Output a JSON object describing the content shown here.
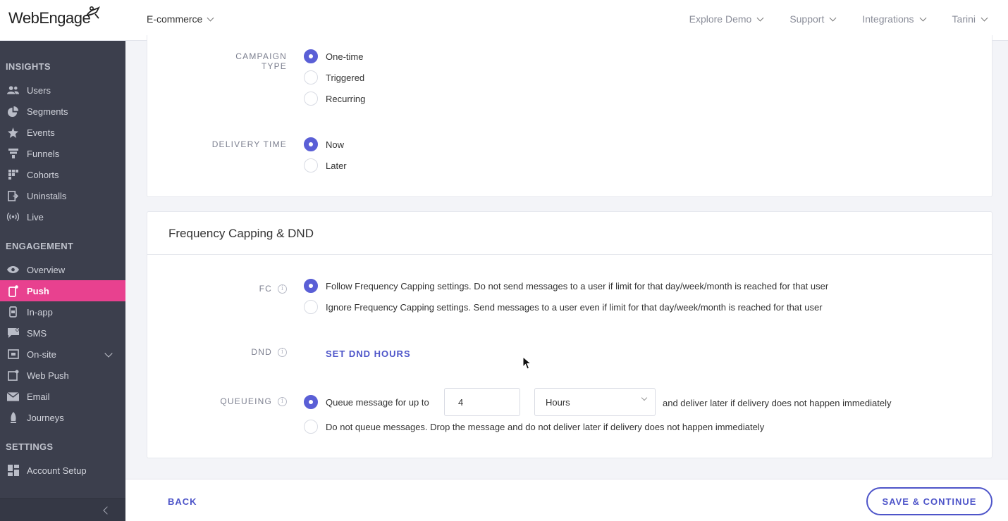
{
  "app": {
    "logo": "WebEngage",
    "project": "E-commerce"
  },
  "topnav": [
    {
      "label": "Explore Demo"
    },
    {
      "label": "Support"
    },
    {
      "label": "Integrations"
    },
    {
      "label": "Tarini"
    }
  ],
  "sidebar": {
    "insights_title": "INSIGHTS",
    "insights": [
      {
        "label": "Users",
        "icon": "users-icon"
      },
      {
        "label": "Segments",
        "icon": "pie-chart-icon"
      },
      {
        "label": "Events",
        "icon": "star-icon"
      },
      {
        "label": "Funnels",
        "icon": "funnel-icon"
      },
      {
        "label": "Cohorts",
        "icon": "grid-icon"
      },
      {
        "label": "Uninstalls",
        "icon": "exit-icon"
      },
      {
        "label": "Live",
        "icon": "broadcast-icon"
      }
    ],
    "engagement_title": "ENGAGEMENT",
    "engagement": [
      {
        "label": "Overview",
        "icon": "eye-icon"
      },
      {
        "label": "Push",
        "icon": "push-icon",
        "active": true
      },
      {
        "label": "In-app",
        "icon": "mobile-icon"
      },
      {
        "label": "SMS",
        "icon": "chat-icon"
      },
      {
        "label": "On-site",
        "icon": "browser-icon",
        "expandable": true
      },
      {
        "label": "Web Push",
        "icon": "web-push-icon"
      },
      {
        "label": "Email",
        "icon": "envelope-icon"
      },
      {
        "label": "Journeys",
        "icon": "journey-icon"
      }
    ],
    "settings_title": "SETTINGS",
    "settings": [
      {
        "label": "Account Setup",
        "icon": "dashboard-icon"
      }
    ],
    "accent_color": "#e8418f"
  },
  "campaign": {
    "type_label": "CAMPAIGN TYPE",
    "type_options": [
      "One-time",
      "Triggered",
      "Recurring"
    ],
    "type_selected": "One-time",
    "delivery_label": "DELIVERY TIME",
    "delivery_options": [
      "Now",
      "Later"
    ],
    "delivery_selected": "Now"
  },
  "fc_section": {
    "title": "Frequency Capping & DND",
    "fc_label": "FC",
    "fc_options": [
      "Follow Frequency Capping settings. Do not send messages to a user if limit for that day/week/month is reached for that user",
      "Ignore Frequency Capping settings. Send messages to a user even if limit for that day/week/month is reached for that user"
    ],
    "dnd_label": "DND",
    "dnd_link": "SET DND HOURS",
    "queue_label": "QUEUEING",
    "queue_option_1_prefix": "Queue message for up to",
    "queue_value": "4",
    "queue_unit": "Hours",
    "queue_option_1_suffix": "and deliver later if delivery does not happen immediately",
    "queue_option_2": "Do not queue messages. Drop the message and do not deliver later if delivery does not happen immediately"
  },
  "footer": {
    "back": "BACK",
    "save": "SAVE & CONTINUE"
  },
  "colors": {
    "primary": "#5a5fd6",
    "sidebar_bg": "#3c3f4d"
  }
}
